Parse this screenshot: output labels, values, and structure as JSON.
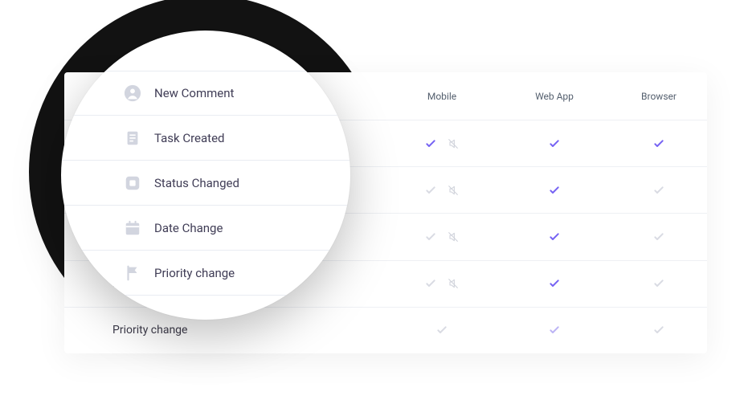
{
  "columns": {
    "mobile": "Mobile",
    "webapp": "Web App",
    "browser": "Browser"
  },
  "items": [
    {
      "label": "New Comment",
      "icon": "person-icon",
      "mobile_check": "on",
      "mobile_mute": true,
      "webapp": "on",
      "browser": "on"
    },
    {
      "label": "Task Created",
      "icon": "document-icon",
      "mobile_check": "off",
      "mobile_mute": true,
      "webapp": "on",
      "browser": "off"
    },
    {
      "label": "Status Changed",
      "icon": "status-icon",
      "mobile_check": "off",
      "mobile_mute": true,
      "webapp": "on",
      "browser": "off"
    },
    {
      "label": "Date Change",
      "icon": "calendar-icon",
      "mobile_check": "off",
      "mobile_mute": true,
      "webapp": "on",
      "browser": "off"
    },
    {
      "label": "Priority change",
      "icon": "flag-icon",
      "mobile_check": "off",
      "mobile_mute": false,
      "webapp": "mid",
      "browser": "off"
    }
  ]
}
